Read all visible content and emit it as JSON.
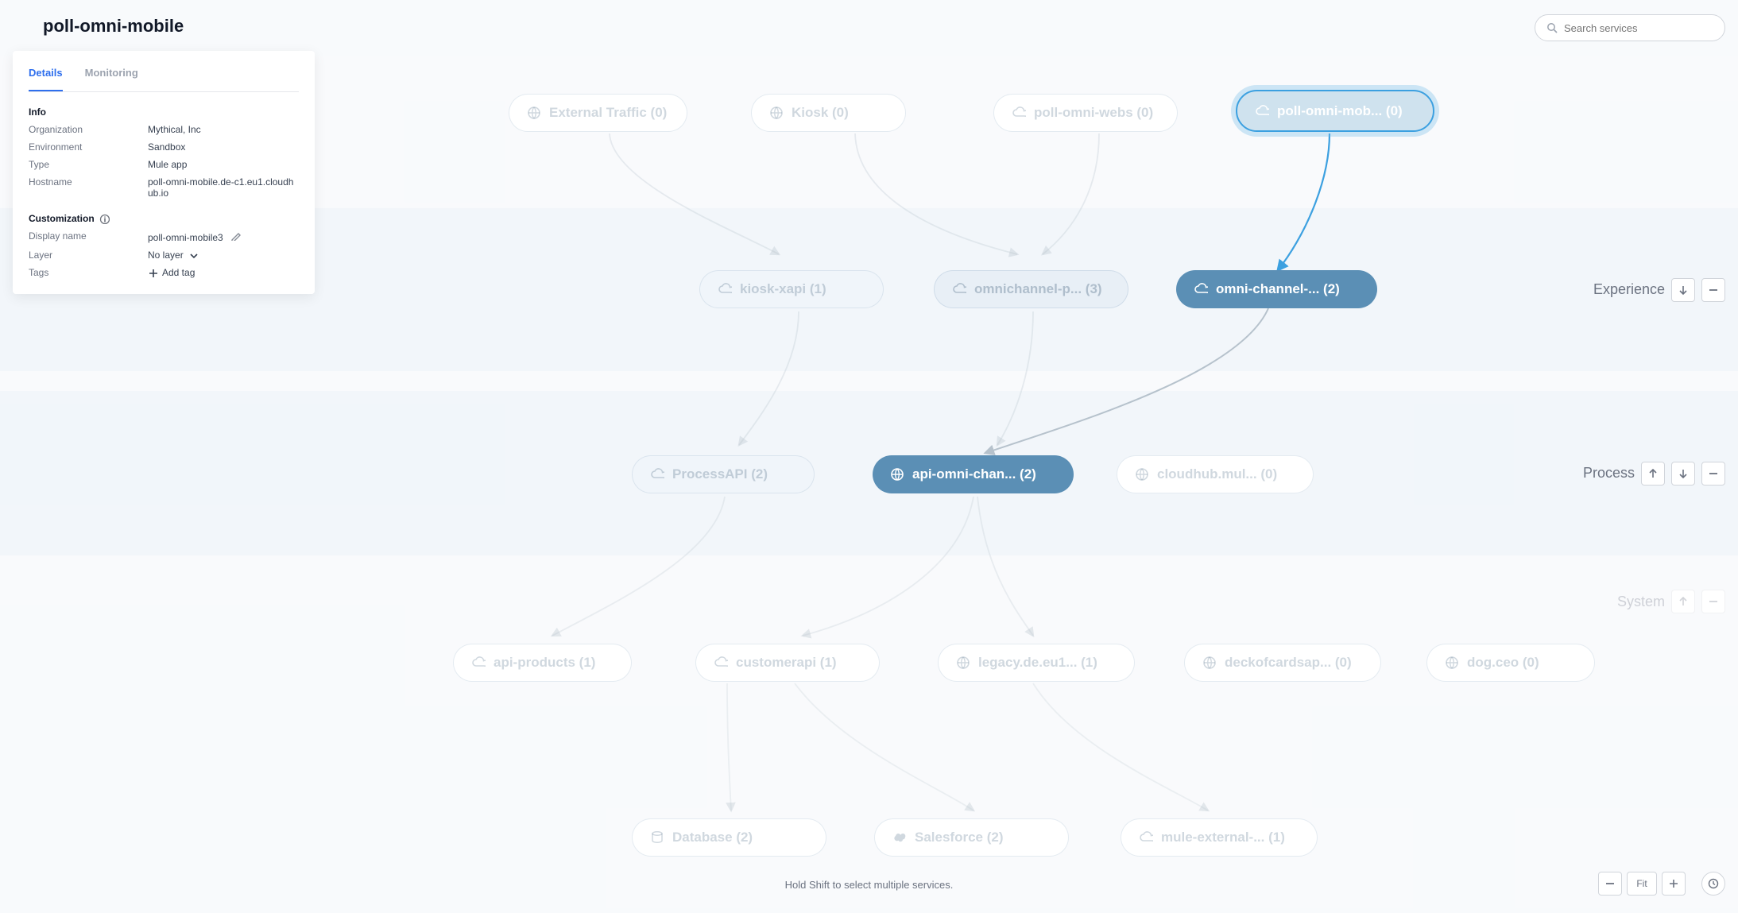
{
  "header": {
    "title": "poll-omni-mobile"
  },
  "search": {
    "placeholder": "Search services"
  },
  "panel": {
    "tabs": {
      "details": "Details",
      "monitoring": "Monitoring"
    },
    "info_h": "Info",
    "info": {
      "org_k": "Organization",
      "org_v": "Mythical, Inc",
      "env_k": "Environment",
      "env_v": "Sandbox",
      "type_k": "Type",
      "type_v": "Mule app",
      "host_k": "Hostname",
      "host_v": "poll-omni-mobile.de-c1.eu1.cloudhub.io"
    },
    "cust_h": "Customization",
    "cust": {
      "disp_k": "Display name",
      "disp_v": "poll-omni-mobile3",
      "layer_k": "Layer",
      "layer_v": "No layer",
      "tags_k": "Tags",
      "tags_v": "Add tag"
    }
  },
  "layers": {
    "top": {
      "label": ""
    },
    "experience": {
      "label": "Experience"
    },
    "process": {
      "label": "Process"
    },
    "system": {
      "label": "System"
    }
  },
  "nodes": {
    "ext_traffic": "External Traffic  (0)",
    "kiosk": "Kiosk  (0)",
    "poll_webs": "poll-omni-webs  (0)",
    "poll_mob": "poll-omni-mob...  (0)",
    "kiosk_xapi": "kiosk-xapi  (1)",
    "omni_p": "omnichannel-p...  (3)",
    "omni_channel": "omni-channel-...  (2)",
    "process_api": "ProcessAPI  (2)",
    "api_omni": "api-omni-chan...  (2)",
    "cloudhub": "cloudhub.mul...  (0)",
    "api_products": "api-products  (1)",
    "customerapi": "customerapi  (1)",
    "legacy": "legacy.de.eu1...  (1)",
    "deckofcards": "deckofcardsap...  (0)",
    "dog": "dog.ceo  (0)",
    "database": "Database  (2)",
    "salesforce": "Salesforce  (2)",
    "mule_ext": "mule-external-...  (1)"
  },
  "hint": "Hold Shift to select multiple services.",
  "zoom": {
    "fit": "Fit"
  }
}
